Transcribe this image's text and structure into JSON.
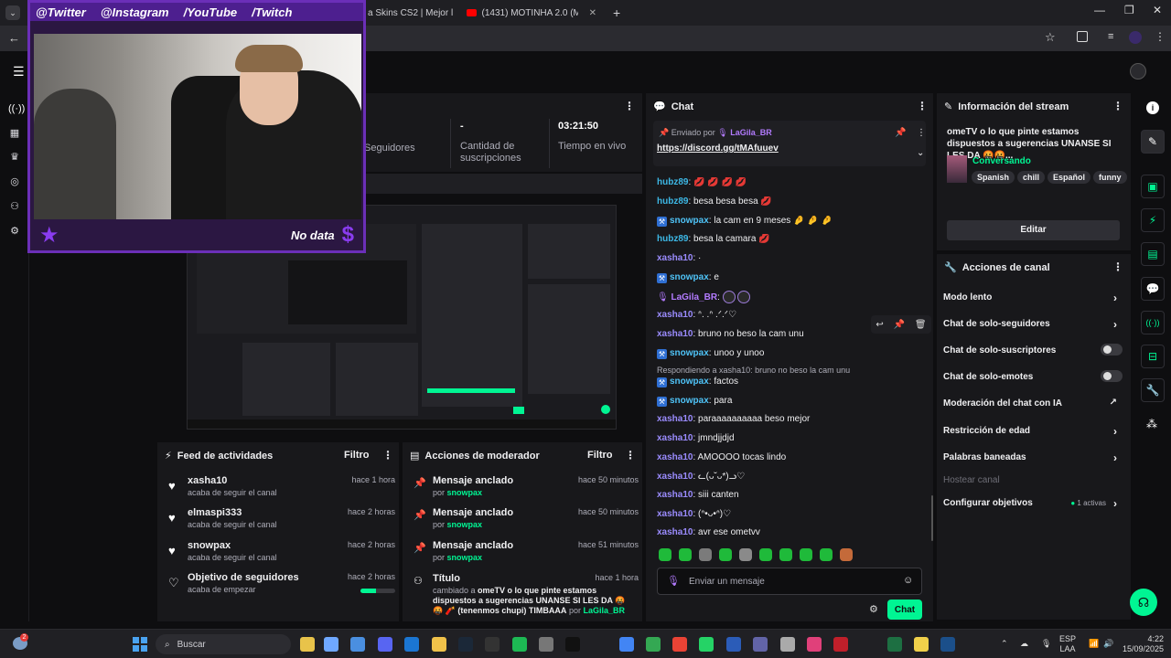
{
  "browser": {
    "tabs": [
      {
        "label": "a Skins CS2 | Mejor l"
      },
      {
        "label": "(1431) MOTINHA 2.0 (Mete Ma"
      }
    ],
    "new_tab": "+",
    "controls": {
      "minimize": "—",
      "maximize": "❐",
      "close": "✕"
    }
  },
  "overlay": {
    "socials": [
      "@Twitter",
      "@Instagram",
      "/YouTube",
      "/Twitch"
    ],
    "footer_text": "No data"
  },
  "stats": {
    "seguidores_label": "Seguidores",
    "suscripciones_value": "-",
    "suscripciones_label": "Cantidad de suscripciones",
    "tiempo_value": "03:21:50",
    "tiempo_label": "Tiempo en vivo"
  },
  "feed": {
    "title": "Feed de actividades",
    "filter": "Filtro",
    "items": [
      {
        "name": "xasha10",
        "sub": "acaba de seguir el canal",
        "time": "hace 1 hora"
      },
      {
        "name": "elmaspi333",
        "sub": "acaba de seguir el canal",
        "time": "hace 2 horas"
      },
      {
        "name": "snowpax",
        "sub": "acaba de seguir el canal",
        "time": "hace 2 horas"
      },
      {
        "name": "Objetivo de seguidores",
        "sub": "acaba de empezar",
        "time": "hace 2 horas",
        "progress": 0.45
      }
    ]
  },
  "mod": {
    "title": "Acciones de moderador",
    "filter": "Filtro",
    "items": [
      {
        "name": "Mensaje anclado",
        "by": "por",
        "user": "snowpax",
        "time": "hace 50 minutos"
      },
      {
        "name": "Mensaje anclado",
        "by": "por",
        "user": "snowpax",
        "time": "hace 50 minutos"
      },
      {
        "name": "Mensaje anclado",
        "by": "por",
        "user": "snowpax",
        "time": "hace 51 minutos"
      },
      {
        "name": "Título",
        "time": "hace 1 hora",
        "desc1": "cambiado a",
        "desc_title": "omeTV o lo que pinte estamos dispuestos a sugerencias UNANSE SI LES DA 🤬🤬 🧨 (tenenmos chupi) TIMBAAA",
        "by": "por",
        "user": "LaGila_BR"
      }
    ]
  },
  "chat": {
    "title": "Chat",
    "pinned_by_label": "Enviado por",
    "pinned_user": "LaGila_BR",
    "pinned_link": "https://discord.gg/tMAfuuev",
    "messages": [
      {
        "user": "hubz89",
        "text": "💋 💋 💋 💋",
        "color": "#3db8e6"
      },
      {
        "user": "hubz89",
        "text": "besa besa besa 💋",
        "color": "#3db8e6"
      },
      {
        "user": "snowpax",
        "text": "la cam en 9 meses 🤌 🤌 🤌",
        "color": "#4fc3f7"
      },
      {
        "user": "hubz89",
        "text": "besa la camara 💋",
        "color": "#3db8e6"
      },
      {
        "user": "xasha10",
        "text": "·",
        "color": "#9b8cff"
      },
      {
        "user": "snowpax",
        "text": "e",
        "color": "#4fc3f7"
      },
      {
        "user": "LaGila_BR",
        "text": "",
        "color": "#b37bff"
      },
      {
        "user": "xasha10",
        "text": "ᐢ. .ᐢ .ᐟ.ᐟ♡",
        "color": "#9b8cff"
      },
      {
        "user": "xasha10",
        "text": "bruno no beso la cam unu",
        "color": "#9b8cff"
      },
      {
        "user": "snowpax",
        "text": "unoo y unoo",
        "color": "#4fc3f7"
      },
      {
        "reply": "Respondiendo a xasha10: bruno no beso la cam unu"
      },
      {
        "user": "snowpax",
        "text": "factos",
        "color": "#4fc3f7"
      },
      {
        "user": "snowpax",
        "text": "para",
        "color": "#4fc3f7"
      },
      {
        "user": "xasha10",
        "text": "paraaaaaaaaaa beso mejor",
        "color": "#9b8cff"
      },
      {
        "user": "xasha10",
        "text": "jmndjjdjd",
        "color": "#9b8cff"
      },
      {
        "user": "xasha10",
        "text": "AMOOOO tocas lindo",
        "color": "#9b8cff"
      },
      {
        "user": "xasha10",
        "text": "ᓚ(ᴗ˘ᴗ*)ᓗ♡",
        "color": "#9b8cff"
      },
      {
        "user": "xasha10",
        "text": "siii canten",
        "color": "#9b8cff"
      },
      {
        "user": "xasha10",
        "text": "(ᐢ•ᴗ•ᐢ)♡",
        "color": "#9b8cff"
      },
      {
        "user": "xasha10",
        "text": "avr ese ometvv",
        "color": "#9b8cff"
      }
    ],
    "input_placeholder": "Enviar un mensaje",
    "send_label": "Chat"
  },
  "info": {
    "title": "Información del stream",
    "stream_title": "omeTV o lo que pinte estamos dispuestos a sugerencias UNANSE SI LES DA 🤬🤬...",
    "category": "Conversando",
    "tags": [
      "Spanish",
      "chill",
      "Español",
      "funny"
    ],
    "edit_label": "Editar"
  },
  "actions": {
    "title": "Acciones de canal",
    "items": [
      {
        "label": "Modo lento",
        "kind": "chevron"
      },
      {
        "label": "Chat de solo-seguidores",
        "kind": "chevron"
      },
      {
        "label": "Chat de solo-suscriptores",
        "kind": "toggle"
      },
      {
        "label": "Chat de solo-emotes",
        "kind": "toggle"
      },
      {
        "label": "Moderación del chat con IA",
        "kind": "external"
      },
      {
        "label": "Restricción de edad",
        "kind": "chevron"
      },
      {
        "label": "Palabras baneadas",
        "kind": "chevron"
      },
      {
        "label": "Hostear canal",
        "kind": "disabled"
      },
      {
        "label": "Configurar objetivos",
        "kind": "chevron",
        "extra": "1 activas"
      }
    ]
  },
  "taskbar": {
    "search_placeholder": "Buscar",
    "notif_badge": "2",
    "lang": "ESP",
    "lang2": "LAA",
    "time": "4:22",
    "date": "15/09/2025"
  },
  "colors": {
    "accent": "#00f593",
    "overlay_purple": "#6b2fb8"
  }
}
